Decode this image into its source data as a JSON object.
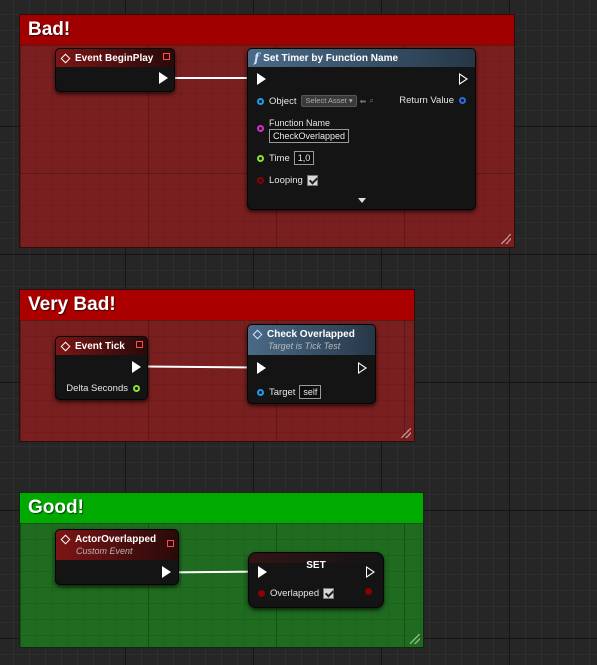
{
  "colors": {
    "bad": "#a00000",
    "very_bad": "#aa0000",
    "good": "#00aa00",
    "exec_wire": "#ffffff"
  },
  "comments": {
    "bad": {
      "title": "Bad!"
    },
    "very_bad": {
      "title": "Very Bad!"
    },
    "good": {
      "title": "Good!"
    }
  },
  "nodes": {
    "event_begin_play": {
      "title": "Event BeginPlay"
    },
    "set_timer": {
      "title": "Set Timer by Function Name",
      "object_label": "Object",
      "select_asset": "Select Asset",
      "return_label": "Return Value",
      "function_name_label": "Function Name",
      "function_name_value": "CheckOverlapped",
      "time_label": "Time",
      "time_value": "1,0",
      "looping_label": "Looping",
      "looping_checked": true
    },
    "event_tick": {
      "title": "Event Tick",
      "delta_label": "Delta Seconds"
    },
    "check_overlapped": {
      "title": "Check Overlapped",
      "subtitle": "Target is Tick Test",
      "target_label": "Target",
      "target_value": "self"
    },
    "actor_overlapped": {
      "title": "ActorOverlapped",
      "subtitle": "Custom Event"
    },
    "set_node": {
      "title": "SET",
      "overlapped_label": "Overlapped",
      "overlapped_checked": true
    }
  }
}
